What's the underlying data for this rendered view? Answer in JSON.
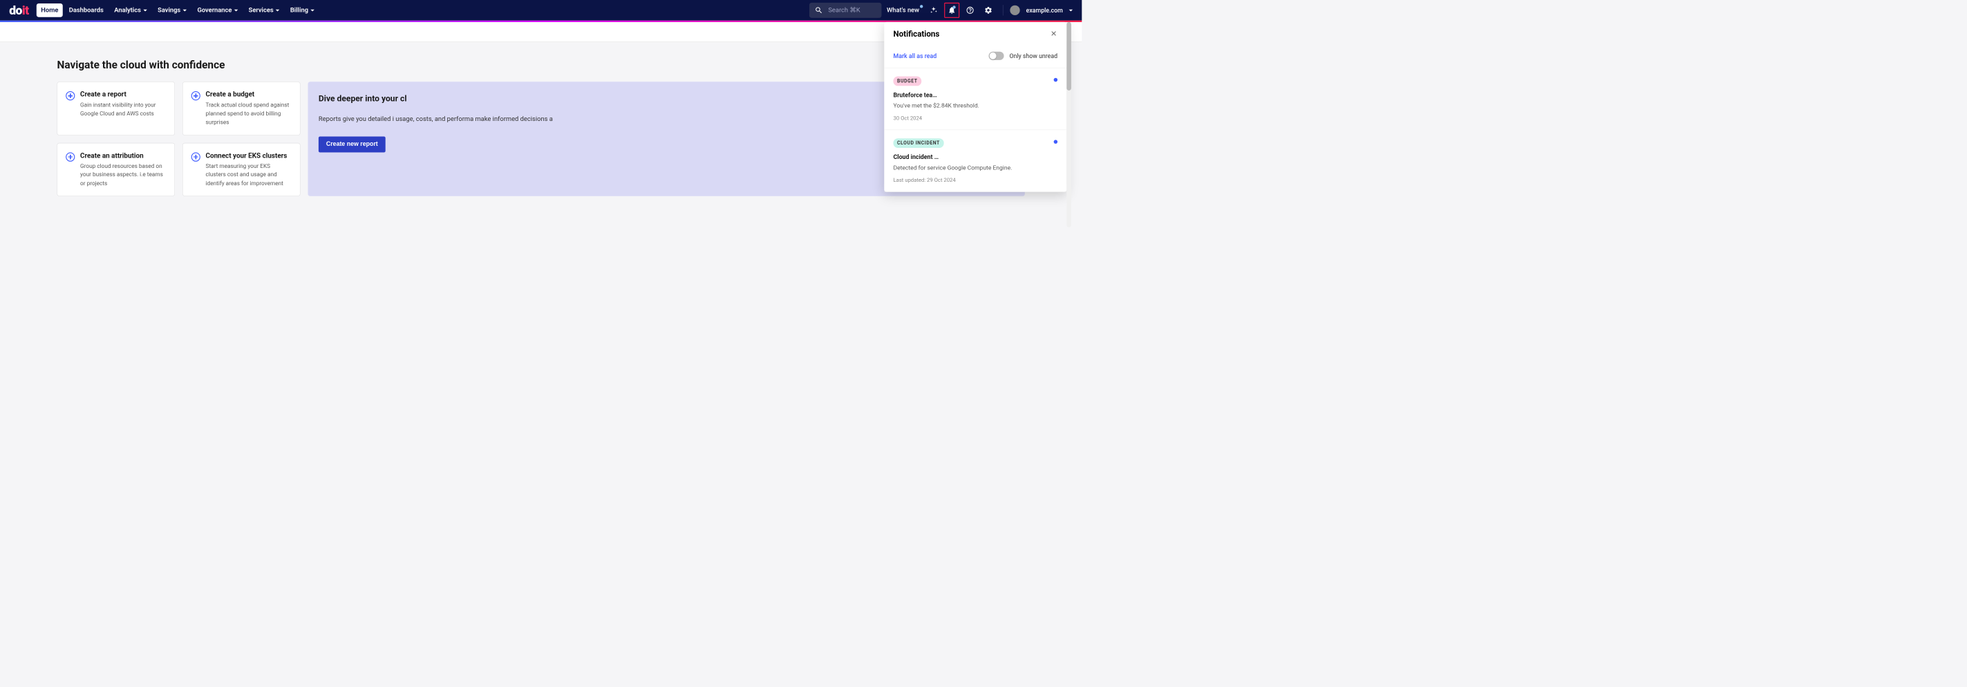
{
  "nav": {
    "home": "Home",
    "dashboards": "Dashboards",
    "analytics": "Analytics",
    "savings": "Savings",
    "governance": "Governance",
    "services": "Services",
    "billing": "Billing"
  },
  "search": {
    "placeholder": "Search ⌘K"
  },
  "top": {
    "whats_new": "What's new",
    "domain": "example.com"
  },
  "page": {
    "title": "Navigate the cloud with confidence"
  },
  "cards": [
    {
      "title": "Create a report",
      "desc": "Gain instant visibility into your Google Cloud and AWS costs"
    },
    {
      "title": "Create a budget",
      "desc": "Track actual cloud spend against planned spend to avoid billing surprises"
    },
    {
      "title": "Create an attribution",
      "desc": "Group cloud resources based on your business aspects. i.e teams or projects"
    },
    {
      "title": "Connect your EKS clusters",
      "desc": "Start measuring your EKS clusters cost and usage and identify areas for improvement"
    }
  ],
  "side": {
    "title": "Dive deeper into your cl",
    "desc": "Reports give you detailed i usage, costs, and performa make informed decisions a",
    "cta": "Create new report"
  },
  "notifications": {
    "title": "Notifications",
    "mark_all": "Mark all as read",
    "filter_label": "Only show unread",
    "items": [
      {
        "badge": "BUDGET",
        "badge_class": "budget",
        "title": "Bruteforce tea…",
        "desc": "You've met the $2.84K threshold.",
        "date": "30 Oct 2024"
      },
      {
        "badge": "CLOUD INCIDENT",
        "badge_class": "incident",
        "title": "Cloud incident …",
        "desc": "Detected for service Google Compute Engine.",
        "date": "Last updated: 29 Oct 2024"
      }
    ]
  }
}
